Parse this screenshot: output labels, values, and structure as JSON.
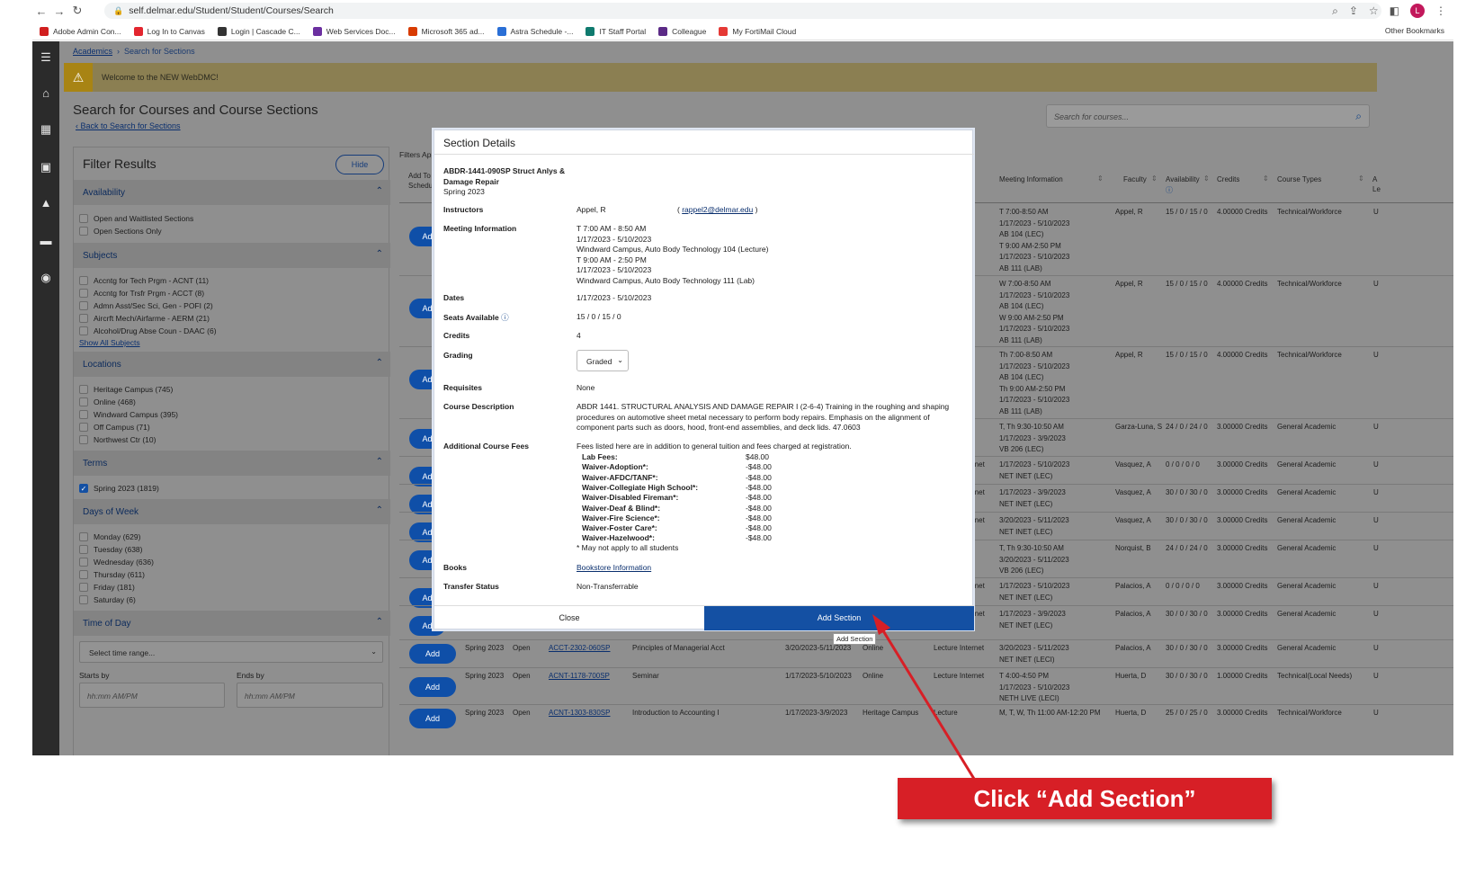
{
  "browser": {
    "url": "self.delmar.edu/Student/Student/Courses/Search",
    "profile_initial": "L",
    "bookmarks": [
      {
        "label": "Adobe Admin Con...",
        "color": "#d11f1f"
      },
      {
        "label": "Log In to Canvas",
        "color": "#e3262f"
      },
      {
        "label": "Login | Cascade C...",
        "color": "#333333"
      },
      {
        "label": "Web Services Doc...",
        "color": "#6b2fa0"
      },
      {
        "label": "Microsoft 365 ad...",
        "color": "#d83b01"
      },
      {
        "label": "Astra Schedule -...",
        "color": "#2a6fd6"
      },
      {
        "label": "IT Staff Portal",
        "color": "#0f7a6e"
      },
      {
        "label": "Colleague",
        "color": "#5b2a86"
      },
      {
        "label": "My FortiMail Cloud",
        "color": "#e53935"
      }
    ],
    "other_bookmarks": "Other Bookmarks"
  },
  "app": {
    "breadcrumb_root": "Academics",
    "breadcrumb_current": "Search for Sections",
    "banner": "Welcome to the NEW WebDMC!",
    "page_title": "Search for Courses and Course Sections",
    "back_link": "Back to Search for Sections",
    "search_placeholder": "Search for courses..."
  },
  "filter": {
    "title": "Filter Results",
    "hide": "Hide",
    "availability": {
      "title": "Availability",
      "options": [
        "Open and Waitlisted Sections",
        "Open Sections Only"
      ]
    },
    "subjects": {
      "title": "Subjects",
      "options": [
        "Accntg for Tech Prgm - ACNT (11)",
        "Accntg for Trsfr Prgm - ACCT (8)",
        "Admn Asst/Sec Sci, Gen - POFI (2)",
        "Aircrft Mech/Airfarme - AERM (21)",
        "Alcohol/Drug Abse Coun - DAAC (6)"
      ],
      "show_all": "Show All Subjects"
    },
    "locations": {
      "title": "Locations",
      "options": [
        "Heritage Campus (745)",
        "Online (468)",
        "Windward Campus (395)",
        "Off Campus (71)",
        "Northwest Ctr (10)"
      ]
    },
    "terms": {
      "title": "Terms",
      "options": [
        "Spring 2023 (1819)"
      ]
    },
    "days": {
      "title": "Days of Week",
      "options": [
        "Monday (629)",
        "Tuesday (638)",
        "Wednesday (636)",
        "Thursday (611)",
        "Friday (181)",
        "Saturday (6)"
      ]
    },
    "time": {
      "title": "Time of Day",
      "select": "Select time range...",
      "starts_by": "Starts by",
      "ends_by": "Ends by",
      "time_placeholder": "hh:mm AM/PM"
    }
  },
  "results": {
    "filters_applied": "Filters App",
    "headers": {
      "add_to": "Add To",
      "schedule": "Schedul",
      "meeting": "Meeting Information",
      "faculty": "Faculty",
      "availability": "Availability",
      "credits": "Credits",
      "course_types": "Course Types",
      "extra1": "A",
      "extra2": "Le"
    },
    "add_label": "Add",
    "row_fragment": "Ad",
    "rows_right": [
      {
        "meeting": [
          "T 7:00-8:50 AM",
          "1/17/2023 - 5/10/2023",
          "AB 104 (LEC)",
          "T 9:00 AM-2:50 PM",
          "1/17/2023 - 5/10/2023",
          "AB 111 (LAB)"
        ],
        "faculty": "Appel, R",
        "avail": "15 / 0 / 15 / 0",
        "credits": "4.00000 Credits",
        "type": "Technical/Workforce",
        "u": "U"
      },
      {
        "meeting": [
          "W 7:00-8:50 AM",
          "1/17/2023 - 5/10/2023",
          "AB 104 (LEC)",
          "W 9:00 AM-2:50 PM",
          "1/17/2023 - 5/10/2023",
          "AB 111 (LAB)"
        ],
        "faculty": "Appel, R",
        "avail": "15 / 0 / 15 / 0",
        "credits": "4.00000 Credits",
        "type": "Technical/Workforce",
        "u": "U"
      },
      {
        "meeting": [
          "Th 7:00-8:50 AM",
          "1/17/2023 - 5/10/2023",
          "AB 104 (LEC)",
          "Th 9:00 AM-2:50 PM",
          "1/17/2023 - 5/10/2023",
          "AB 111 (LAB)"
        ],
        "faculty": "Appel, R",
        "avail": "15 / 0 / 15 / 0",
        "credits": "4.00000 Credits",
        "type": "Technical/Workforce",
        "u": "U"
      },
      {
        "meeting": [
          "T, Th 9:30-10:50 AM",
          "1/17/2023 - 3/9/2023",
          "VB 206 (LEC)"
        ],
        "faculty": "Garza-Luna, S",
        "avail": "24 / 0 / 24 / 0",
        "credits": "3.00000 Credits",
        "type": "General Academic",
        "u": "U"
      },
      {
        "meeting": [
          "1/17/2023 - 5/10/2023",
          "NET INET (LEC)"
        ],
        "prefix": "rnet",
        "faculty": "Vasquez, A",
        "avail": "0 / 0 / 0 / 0",
        "credits": "3.00000 Credits",
        "type": "General Academic",
        "u": "U"
      },
      {
        "meeting": [
          "1/17/2023 - 3/9/2023",
          "NET INET (LEC)"
        ],
        "prefix": "rnet",
        "faculty": "Vasquez, A",
        "avail": "30 / 0 / 30 / 0",
        "credits": "3.00000 Credits",
        "type": "General Academic",
        "u": "U"
      },
      {
        "meeting": [
          "3/20/2023 - 5/11/2023",
          "NET INET (LEC)"
        ],
        "prefix": "rnet",
        "faculty": "Vasquez, A",
        "avail": "30 / 0 / 30 / 0",
        "credits": "3.00000 Credits",
        "type": "General Academic",
        "u": "U"
      },
      {
        "meeting": [
          "T, Th 9:30-10:50 AM",
          "3/20/2023 - 5/11/2023",
          "VB 206 (LEC)"
        ],
        "faculty": "Norquist, B",
        "avail": "24 / 0 / 24 / 0",
        "credits": "3.00000 Credits",
        "type": "General Academic",
        "u": "U"
      },
      {
        "meeting": [
          "1/17/2023 - 5/10/2023",
          "NET INET (LEC)"
        ],
        "prefix": "rnet",
        "faculty": "Palacios, A",
        "avail": "0 / 0 / 0 / 0",
        "credits": "3.00000 Credits",
        "type": "General Academic",
        "u": "U"
      },
      {
        "meeting": [
          "1/17/2023 - 3/9/2023",
          "NET INET (LEC)"
        ],
        "prefix": "rnet",
        "faculty": "Palacios, A",
        "avail": "30 / 0 / 30 / 0",
        "credits": "3.00000 Credits",
        "type": "General Academic",
        "u": "U"
      }
    ],
    "rows_full": [
      {
        "term": "Spring 2023",
        "status": "Open",
        "code": "ACCT-2302-060SP",
        "title": "Principles of Managerial Acct",
        "dates": "3/20/2023-5/11/2023",
        "location": "Online",
        "method": "Lecture Internet",
        "meeting": [
          "3/20/2023 - 5/11/2023",
          "NET INET (LECI)"
        ],
        "faculty": "Palacios, A",
        "avail": "30 / 0 / 30 / 0",
        "credits": "3.00000 Credits",
        "type": "General Academic",
        "u": "U"
      },
      {
        "term": "Spring 2023",
        "status": "Open",
        "code": "ACNT-1178-700SP",
        "title": "Seminar",
        "dates": "1/17/2023-5/10/2023",
        "location": "Online",
        "method": "Lecture Internet",
        "meeting": [
          "T 4:00-4:50 PM",
          "1/17/2023 - 5/10/2023",
          "NETH LIVE (LECI)"
        ],
        "faculty": "Huerta, D",
        "avail": "30 / 0 / 30 / 0",
        "credits": "1.00000 Credits",
        "type": "Technical(Local Needs)",
        "u": "U"
      },
      {
        "term": "Spring 2023",
        "status": "Open",
        "code": "ACNT-1303-830SP",
        "title": "Introduction to Accounting I",
        "dates": "1/17/2023-3/9/2023",
        "location": "Heritage Campus",
        "method": "Lecture",
        "meeting": [
          "M, T, W, Th 11:00 AM-12:20 PM"
        ],
        "faculty": "Huerta, D",
        "avail": "25 / 0 / 25 / 0",
        "credits": "3.00000 Credits",
        "type": "Technical/Workforce",
        "u": "U"
      }
    ]
  },
  "modal": {
    "title": "Section Details",
    "section_name": "ABDR-1441-090SP Struct Anlys & Damage Repair",
    "term": "Spring 2023",
    "labels": {
      "instructors": "Instructors",
      "meeting": "Meeting Information",
      "dates": "Dates",
      "seats": "Seats Available",
      "credits": "Credits",
      "grading": "Grading",
      "requisites": "Requisites",
      "description": "Course Description",
      "fees": "Additional Course Fees",
      "books": "Books",
      "transfer": "Transfer Status"
    },
    "instructor": "Appel, R",
    "instructor_email": "rappel2@delmar.edu",
    "meeting": [
      "T 7:00 AM - 8:50 AM",
      "1/17/2023 - 5/10/2023",
      "Windward Campus, Auto Body Technology 104 (Lecture)",
      "T 9:00 AM - 2:50 PM",
      "1/17/2023 - 5/10/2023",
      "Windward Campus, Auto Body Technology 111 (Lab)"
    ],
    "dates": "1/17/2023 - 5/10/2023",
    "seats": "15 / 0 / 15 / 0",
    "credits": "4",
    "grading": "Graded",
    "requisites": "None",
    "description": [
      "ABDR 1441. STRUCTURAL ANALYSIS AND DAMAGE REPAIR I (2-6-4) Training in the roughing and shaping",
      "procedures on automotive sheet metal necessary to perform body repairs. Emphasis on the alignment of",
      "component parts such as doors, hood, front-end assemblies, and deck lids. 47.0603"
    ],
    "fees_intro": "Fees listed here are in addition to general tuition and fees charged at registration.",
    "fees": [
      {
        "name": "Lab Fees:",
        "amount": "$48.00"
      },
      {
        "name": "Waiver-Adoption*:",
        "amount": "-$48.00"
      },
      {
        "name": "Waiver-AFDC/TANF*:",
        "amount": "-$48.00"
      },
      {
        "name": "Waiver-Collegiate High School*:",
        "amount": "-$48.00"
      },
      {
        "name": "Waiver-Disabled Fireman*:",
        "amount": "-$48.00"
      },
      {
        "name": "Waiver-Deaf & Blind*:",
        "amount": "-$48.00"
      },
      {
        "name": "Waiver-Fire Science*:",
        "amount": "-$48.00"
      },
      {
        "name": "Waiver-Foster Care*:",
        "amount": "-$48.00"
      },
      {
        "name": "Waiver-Hazelwood*:",
        "amount": "-$48.00"
      }
    ],
    "fees_note": "* May not apply to all students",
    "books": "Bookstore Information",
    "transfer": "Non-Transferrable",
    "close": "Close",
    "add_section": "Add Section",
    "tooltip": "Add Section"
  },
  "callout": {
    "text": "Click “Add Section”",
    "color": "#d71f26"
  }
}
